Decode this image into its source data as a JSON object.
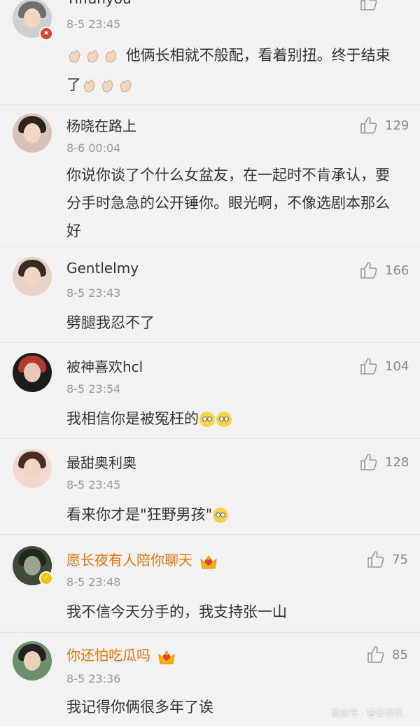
{
  "comments": [
    {
      "username": "Tiffanyou",
      "time": "8-5 23:45",
      "text_after": "他俩长相就不般配，看着别扭。终于结束了",
      "like_count": ""
    },
    {
      "username": "杨晓在路上",
      "time": "8-6 00:04",
      "text": "你说你谈了个什么女盆友，在一起时不肯承认，要分手时急急的公开锤你。眼光啊，不像选剧本那么好",
      "like_count": "129"
    },
    {
      "username": "Gentlelmy",
      "time": "8-5 23:43",
      "text": "劈腿我忍不了",
      "like_count": "166"
    },
    {
      "username": "被神喜欢hcl",
      "time": "8-5 23:54",
      "text": "我相信你是被冤枉的",
      "like_count": "104"
    },
    {
      "username": "最甜奥利奥",
      "time": "8-5 23:45",
      "text": "看来你才是\"狂野男孩\"",
      "like_count": "128"
    },
    {
      "username": "愿长夜有人陪你聊天",
      "time": "8-5 23:48",
      "text": "我不信今天分手的，我支持张一山",
      "like_count": "75"
    },
    {
      "username": "你还怕吃瓜吗",
      "time": "8-5 23:36",
      "text": "我记得你俩很多年了诶",
      "like_count": "85"
    }
  ],
  "watermark": "百家号 · 奢日快讯",
  "colors": {
    "background": "#f2f2f2",
    "vip_name": "#e8740c",
    "meta": "#999999",
    "divider": "#e4e4e4"
  },
  "icons": {
    "like": "thumbs-up-icon",
    "crown": "crown-heart-icon",
    "clap": "clapping-hands-emoji",
    "smile": "rolling-eyes-emoji"
  }
}
